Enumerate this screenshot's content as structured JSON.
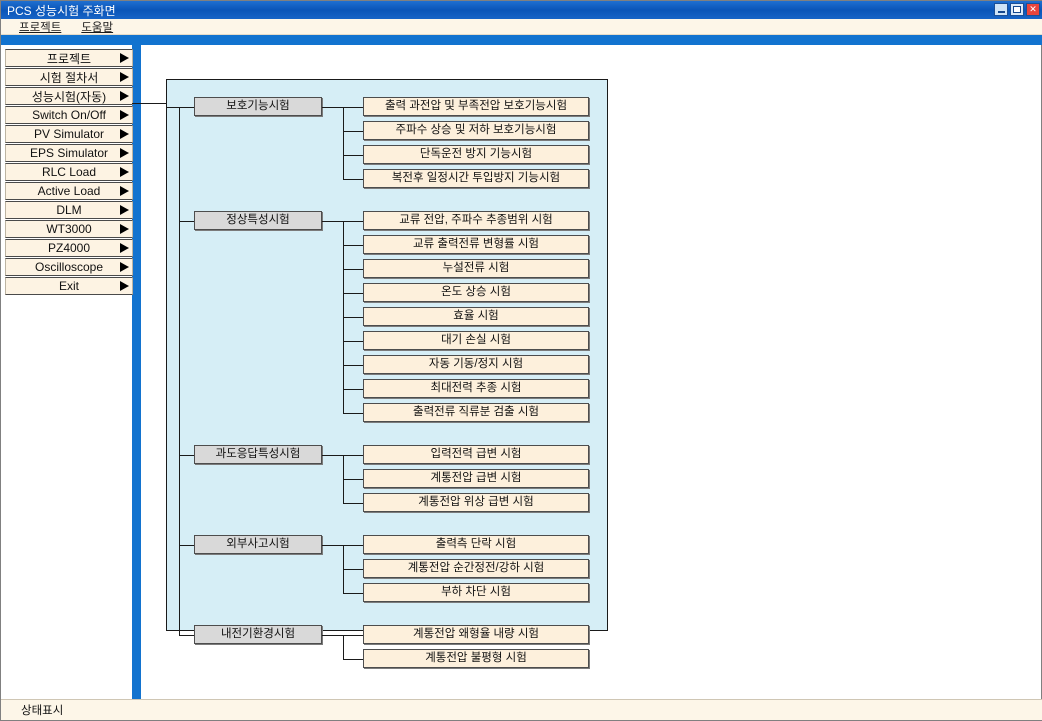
{
  "window": {
    "title": "PCS 성능시험 주화면",
    "controls": [
      {
        "name": "minimize-button",
        "label": "_"
      },
      {
        "name": "maximize-button",
        "label": "□"
      },
      {
        "name": "close-button",
        "label": "✕"
      }
    ]
  },
  "menubar": {
    "items": [
      {
        "label": "프로젝트"
      },
      {
        "label": "도움말"
      }
    ]
  },
  "sidebar": {
    "items": [
      {
        "label": "프로젝트"
      },
      {
        "label": "시험 절차서"
      },
      {
        "label": "성능시험(자동)"
      },
      {
        "label": "Switch On/Off"
      },
      {
        "label": "PV Simulator"
      },
      {
        "label": "EPS Simulator"
      },
      {
        "label": "RLC Load"
      },
      {
        "label": "Active Load"
      },
      {
        "label": "DLM"
      },
      {
        "label": "WT3000"
      },
      {
        "label": "PZ4000"
      },
      {
        "label": "Oscilloscope"
      },
      {
        "label": "Exit"
      }
    ]
  },
  "diagram": {
    "groups": [
      {
        "parent": "보호기능시험",
        "children": [
          "출력 과전압 및 부족전압 보호기능시험",
          "주파수 상승 및 저하 보호기능시험",
          "단독운전 방지 기능시험",
          "복전후 일정시간 투입방지 기능시험"
        ]
      },
      {
        "parent": "정상특성시험",
        "children": [
          "교류 전압, 주파수 추종범위 시험",
          "교류 출력전류 변형률 시험",
          "누설전류 시험",
          "온도 상승 시험",
          "효율 시험",
          "대기 손실 시험",
          "자동 기동/정지 시험",
          "최대전력 추종 시험",
          "출력전류 직류분 검출 시험"
        ]
      },
      {
        "parent": "과도응답특성시험",
        "children": [
          "입력전력 급변 시험",
          "계통전압 급변 시험",
          "계통전압 위상 급변 시험"
        ]
      },
      {
        "parent": "외부사고시험",
        "children": [
          "출력측 단락 시험",
          "계통전압 순간정전/강하 시험",
          "부하 차단 시험"
        ]
      },
      {
        "parent": "내전기환경시험",
        "children": [
          "계통전압 왜형율 내량 시험",
          "계통전압 불평형 시험"
        ]
      }
    ]
  },
  "statusbar": {
    "text": "상태표시"
  },
  "colors": {
    "title_blue": "#0a55b8",
    "accent_blue": "#1273cf",
    "panel_bg": "#d6eef6",
    "parent_node": "#d9d9d9",
    "child_node": "#fdf0dc",
    "sidebar_item": "#fdf3e3",
    "close_red": "#e8453c"
  }
}
